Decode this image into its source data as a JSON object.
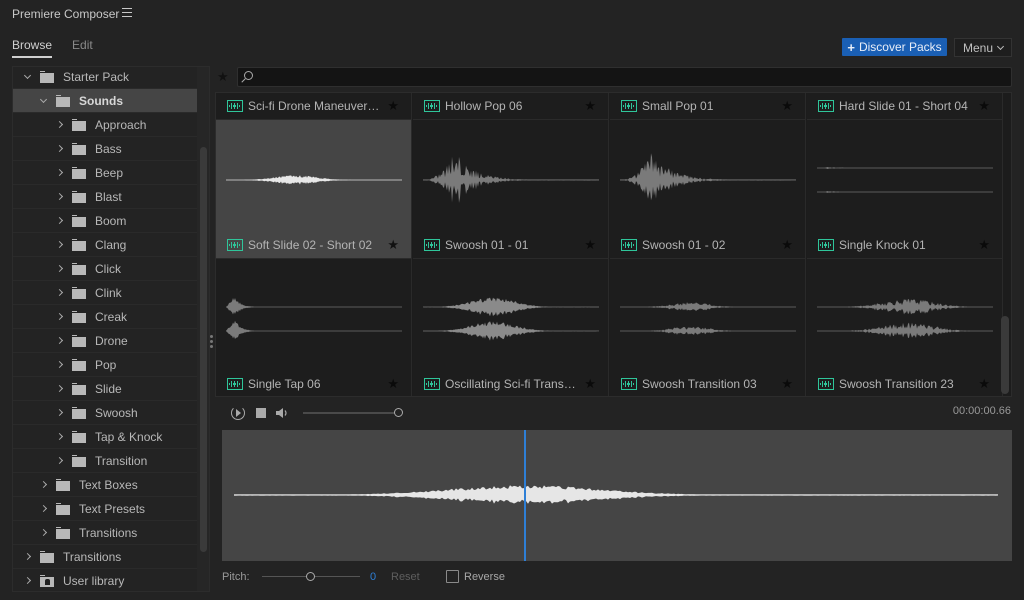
{
  "app": {
    "title": "Premiere Composer",
    "menu_icon": "hamburger-icon"
  },
  "tabs": [
    {
      "label": "Browse",
      "active": true
    },
    {
      "label": "Edit",
      "active": false
    }
  ],
  "header": {
    "discover_label": "Discover Packs",
    "discover_icon": "plus-icon",
    "menu_label": "Menu",
    "accent_color": "#1a5fb4"
  },
  "sidebar": {
    "items": [
      {
        "label": "Starter Pack",
        "level": 0,
        "expanded": true,
        "icon": "folder-icon",
        "selected": false
      },
      {
        "label": "Sounds",
        "level": 1,
        "expanded": true,
        "icon": "folder-icon",
        "selected": true
      },
      {
        "label": "Approach",
        "level": 2,
        "expanded": false,
        "icon": "folder-icon",
        "selected": false
      },
      {
        "label": "Bass",
        "level": 2,
        "expanded": false,
        "icon": "folder-icon",
        "selected": false
      },
      {
        "label": "Beep",
        "level": 2,
        "expanded": false,
        "icon": "folder-icon",
        "selected": false
      },
      {
        "label": "Blast",
        "level": 2,
        "expanded": false,
        "icon": "folder-icon",
        "selected": false
      },
      {
        "label": "Boom",
        "level": 2,
        "expanded": false,
        "icon": "folder-icon",
        "selected": false
      },
      {
        "label": "Clang",
        "level": 2,
        "expanded": false,
        "icon": "folder-icon",
        "selected": false
      },
      {
        "label": "Click",
        "level": 2,
        "expanded": false,
        "icon": "folder-icon",
        "selected": false
      },
      {
        "label": "Clink",
        "level": 2,
        "expanded": false,
        "icon": "folder-icon",
        "selected": false
      },
      {
        "label": "Creak",
        "level": 2,
        "expanded": false,
        "icon": "folder-icon",
        "selected": false
      },
      {
        "label": "Drone",
        "level": 2,
        "expanded": false,
        "icon": "folder-icon",
        "selected": false
      },
      {
        "label": "Pop",
        "level": 2,
        "expanded": false,
        "icon": "folder-icon",
        "selected": false
      },
      {
        "label": "Slide",
        "level": 2,
        "expanded": false,
        "icon": "folder-icon",
        "selected": false
      },
      {
        "label": "Swoosh",
        "level": 2,
        "expanded": false,
        "icon": "folder-icon",
        "selected": false
      },
      {
        "label": "Tap & Knock",
        "level": 2,
        "expanded": false,
        "icon": "folder-icon",
        "selected": false
      },
      {
        "label": "Transition",
        "level": 2,
        "expanded": false,
        "icon": "folder-icon",
        "selected": false
      },
      {
        "label": "Text Boxes",
        "level": 1,
        "expanded": false,
        "icon": "folder-icon",
        "selected": false
      },
      {
        "label": "Text Presets",
        "level": 1,
        "expanded": false,
        "icon": "folder-icon",
        "selected": false
      },
      {
        "label": "Transitions",
        "level": 1,
        "expanded": false,
        "icon": "folder-icon",
        "selected": false
      },
      {
        "label": "Transitions",
        "level": 0,
        "expanded": false,
        "icon": "folder-icon",
        "selected": false
      },
      {
        "label": "User library",
        "level": 0,
        "expanded": false,
        "icon": "user-folder-icon",
        "selected": false
      }
    ]
  },
  "search": {
    "value": "",
    "placeholder": "",
    "favorites_filter_icon": "star-icon"
  },
  "grid": {
    "items": [
      {
        "name": "Sci-fi Drone Maneuver ...",
        "wave": "none",
        "selected": false
      },
      {
        "name": "Hollow Pop 06",
        "wave": "none",
        "selected": false
      },
      {
        "name": "Small Pop 01",
        "wave": "none",
        "selected": false
      },
      {
        "name": "Hard Slide 01 - Short 04",
        "wave": "none",
        "selected": false
      },
      {
        "name": "Soft Slide 02 - Short 02",
        "wave": "swell-mono",
        "selected": true
      },
      {
        "name": "Swoosh 01 - 01",
        "wave": "burst-mono",
        "selected": false
      },
      {
        "name": "Swoosh 01 - 02",
        "wave": "burst-mono",
        "selected": false
      },
      {
        "name": "Single Knock 01",
        "wave": "knock-stereo",
        "selected": false
      },
      {
        "name": "Single Tap 06",
        "wave": "tap-stereo",
        "selected": false
      },
      {
        "name": "Oscillating Sci-fi Transit...",
        "wave": "swell-stereo",
        "selected": false
      },
      {
        "name": "Swoosh Transition 03",
        "wave": "soft-stereo",
        "selected": false
      },
      {
        "name": "Swoosh Transition 23",
        "wave": "noise-stereo",
        "selected": false
      }
    ],
    "item_icon": "audio-file-icon",
    "favorite_icon": "star-icon",
    "icon_color": "#2fc59a"
  },
  "player": {
    "replay_icon": "replay-icon",
    "stop_icon": "stop-icon",
    "volume_icon": "volume-icon",
    "volume_level": 1.0,
    "timecode": "00:00:00.66",
    "playhead_position": 0.38,
    "playhead_color": "#2e7fd6"
  },
  "pitch": {
    "label": "Pitch:",
    "value": "0",
    "slider_position": 0.5,
    "reset_label": "Reset",
    "reverse_label": "Reverse",
    "reverse_checked": false
  }
}
